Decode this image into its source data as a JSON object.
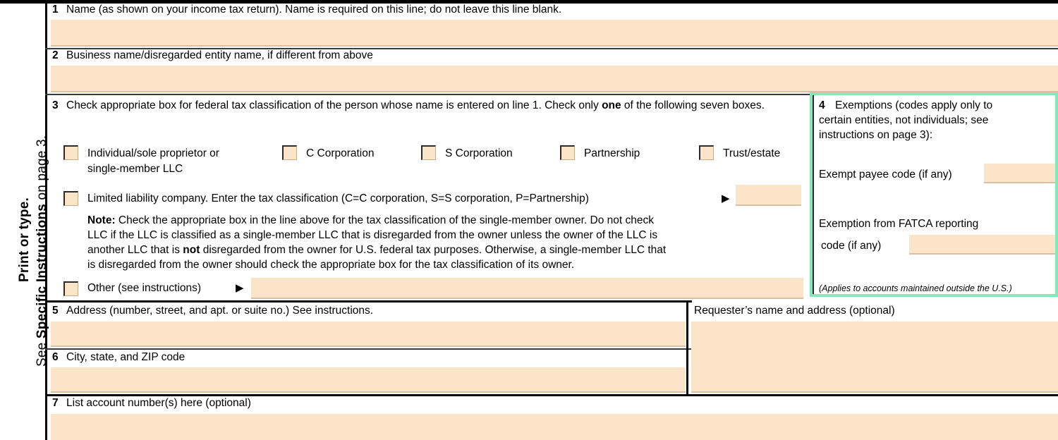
{
  "form": {
    "side_caption_line1": "Print or type.",
    "side_caption_line2_prefix": "See ",
    "side_caption_line2_bold": "Specific Instructions",
    "side_caption_line2_suffix": " on page 3."
  },
  "line1": {
    "number": "1",
    "label": "Name (as shown on your income tax return). Name is required on this line; do not leave this line blank.",
    "value": ""
  },
  "line2": {
    "number": "2",
    "label": "Business name/disregarded entity name, if different from above",
    "value": ""
  },
  "line3": {
    "number": "3",
    "instruction_part1": "Check appropriate box for federal tax classification of the person whose name is entered on line 1. Check only ",
    "instruction_bold": "one",
    "instruction_part2": " of the following seven boxes.",
    "checkboxes": [
      {
        "id": "individual-sole-proprietor",
        "label_line1": "Individual/sole proprietor or",
        "label_line2": "single-member LLC",
        "checked": false
      },
      {
        "id": "c-corporation",
        "label_line1": "C Corporation",
        "label_line2": "",
        "checked": false
      },
      {
        "id": "s-corporation",
        "label_line1": "S Corporation",
        "label_line2": "",
        "checked": false
      },
      {
        "id": "partnership",
        "label_line1": "Partnership",
        "label_line2": "",
        "checked": false
      },
      {
        "id": "trust-estate",
        "label_line1": "Trust/estate",
        "label_line2": "",
        "checked": false
      }
    ],
    "llc": {
      "label": "Limited liability company. Enter the tax classification (C=C corporation, S=S corporation, P=Partnership)",
      "arrow": "▶",
      "value": "",
      "checked": false
    },
    "note": {
      "bold_lead": "Note:",
      "line1": " Check the appropriate box in the line above for the tax classification of the single-member owner.  Do not check",
      "line2": "LLC if the LLC is classified as a single-member LLC that is disregarded from the owner unless the owner of the LLC is",
      "line3_a": "another LLC that is ",
      "line3_bold": "not",
      "line3_b": " disregarded from the owner for U.S. federal tax purposes. Otherwise, a single-member LLC that",
      "line4": "is disregarded from the owner should check the appropriate box for the tax classification of its owner."
    },
    "other": {
      "label": "Other (see instructions)",
      "arrow": "▶",
      "value": "",
      "checked": false
    }
  },
  "line4": {
    "number": "4",
    "heading_line1": "Exemptions (codes apply only to",
    "heading_line2": "certain entities, not individuals; see",
    "heading_line3": "instructions on page 3):",
    "exempt_payee_label": "Exempt payee code (if any)",
    "exempt_payee_value": "",
    "fatca_label_line1": "Exemption from FATCA reporting",
    "fatca_label_line2": "code (if any)",
    "fatca_value": "",
    "footnote": "(Applies to accounts maintained outside the U.S.)",
    "highlight_color": "#86e8b9"
  },
  "line5": {
    "number": "5",
    "label": "Address (number, street, and apt. or suite no.) See instructions.",
    "value": ""
  },
  "line6": {
    "number": "6",
    "label": "City, state, and ZIP code",
    "value": ""
  },
  "line7": {
    "number": "7",
    "label": "List account number(s) here (optional)",
    "value": ""
  },
  "requester": {
    "label": "Requester’s name and address (optional)",
    "value": ""
  },
  "colors": {
    "field_fill": "#fce4c9",
    "field_underline": "#d8c0a0",
    "rule": "#000000",
    "highlight": "#86e8b9"
  }
}
